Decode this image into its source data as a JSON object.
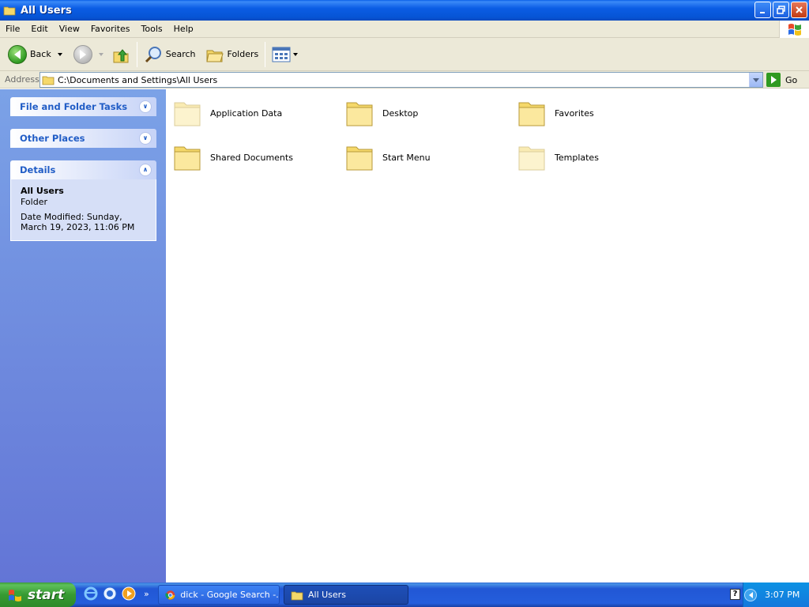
{
  "window": {
    "title": "All Users",
    "buttons": {
      "minimize": "minimize",
      "restore": "restore",
      "close": "close"
    }
  },
  "menu": [
    "File",
    "Edit",
    "View",
    "Favorites",
    "Tools",
    "Help"
  ],
  "toolbar": {
    "back_label": "Back",
    "search_label": "Search",
    "folders_label": "Folders"
  },
  "address": {
    "label": "Address",
    "value": "C:\\Documents and Settings\\All Users",
    "go_label": "Go"
  },
  "sidebar": {
    "panels": [
      {
        "title": "File and Folder Tasks",
        "state": "collapsed"
      },
      {
        "title": "Other Places",
        "state": "collapsed"
      },
      {
        "title": "Details",
        "state": "expanded"
      }
    ],
    "details": {
      "name": "All Users",
      "type": "Folder",
      "date_modified": "Date Modified: Sunday, March 19, 2023, 11:06 PM"
    }
  },
  "items": [
    {
      "label": "Application Data",
      "hidden": true
    },
    {
      "label": "Desktop",
      "hidden": false
    },
    {
      "label": "Favorites",
      "hidden": false
    },
    {
      "label": "Shared Documents",
      "hidden": false
    },
    {
      "label": "Start Menu",
      "hidden": false
    },
    {
      "label": "Templates",
      "hidden": true
    }
  ],
  "taskbar": {
    "start_label": "start",
    "tasks": [
      {
        "label": "dick - Google Search -...",
        "active": false
      },
      {
        "label": "All Users",
        "active": true
      }
    ],
    "clock": "3:07 PM"
  },
  "colors": {
    "titlebar": "#0654d4",
    "sidebar": "#6375d6",
    "panel_title": "#215dc6",
    "folder_yellow": "#f5d86a",
    "start_green": "#379a32"
  }
}
